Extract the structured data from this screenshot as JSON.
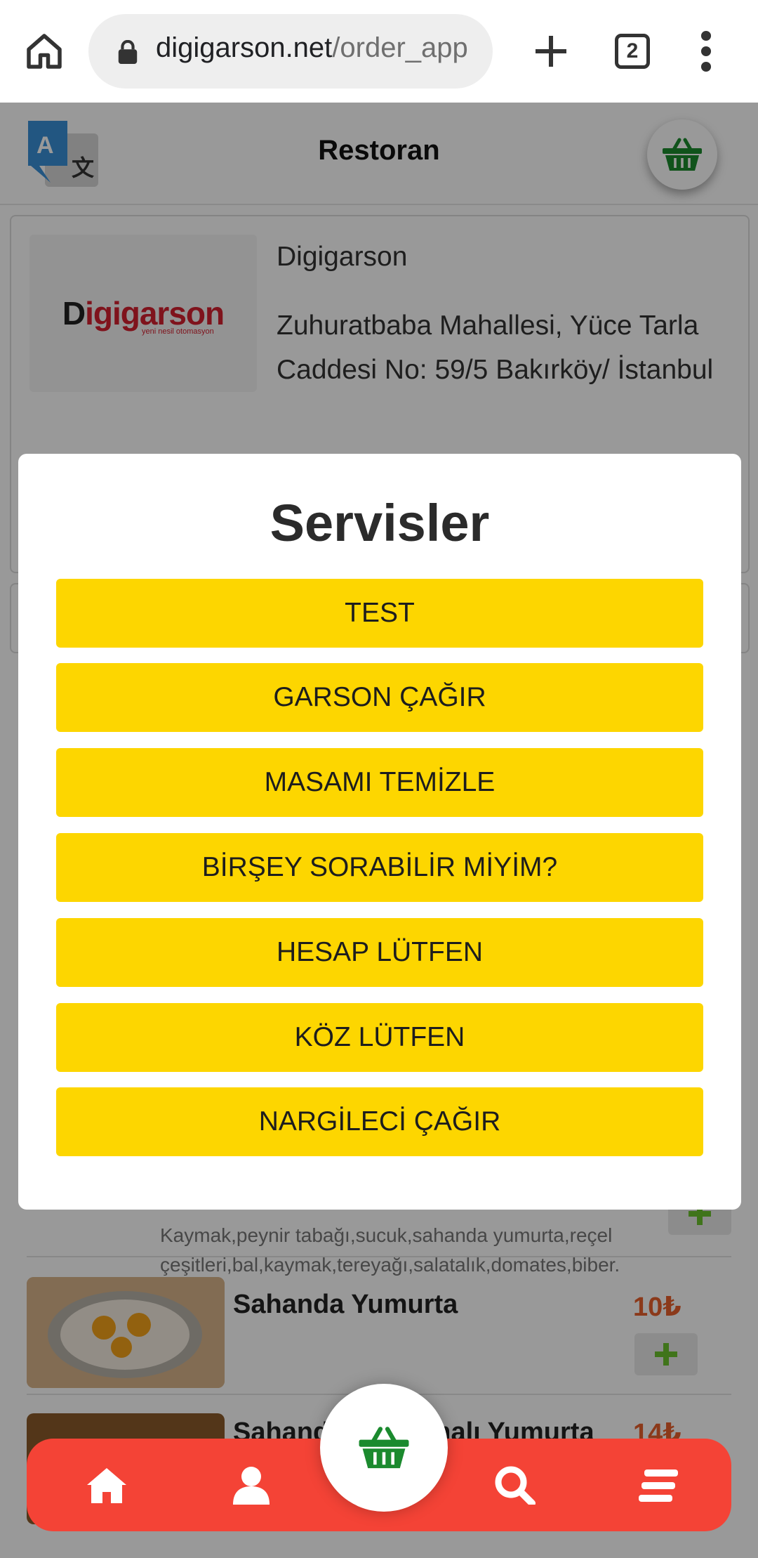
{
  "browser": {
    "url_host": "digigarson.net",
    "url_path": "/order_app",
    "tab_count": "2"
  },
  "header": {
    "title": "Restoran"
  },
  "restaurant": {
    "logo_text_d": "D",
    "logo_text_rest": "igigarson",
    "logo_tagline": "yeni nesil otomasyon",
    "name": "Digigarson",
    "address": "Zuhuratbaba Mahallesi, Yüce Tarla Caddesi No: 59/5 Bakırköy/ İstanbul"
  },
  "products": [
    {
      "description": "Kaymak,peynir tabağı,sucuk,sahanda yumurta,reçel çeşitleri,bal,kaymak,tereyağı,salatalık,domates,biber."
    },
    {
      "name": "Sahanda Yumurta",
      "price": "10₺"
    },
    {
      "name": "Sahanda Kavurmalı Yumurta",
      "price": "14₺"
    }
  ],
  "modal": {
    "title": "Servisler",
    "services": [
      "TEST",
      "GARSON ÇAĞIR",
      "MASAMI TEMİZLE",
      "BİRŞEY SORABİLİR MİYİM?",
      "HESAP LÜTFEN",
      "KÖZ LÜTFEN",
      "NARGİLECİ ÇAĞIR"
    ]
  },
  "icons": {
    "browser": [
      "home-icon",
      "lock-icon",
      "plus-icon",
      "tabs-icon",
      "more-vert-icon"
    ],
    "header": [
      "translate-icon",
      "basket-icon"
    ],
    "bottom_nav": [
      "home-icon",
      "user-icon",
      "basket-icon",
      "search-icon",
      "menu-icon"
    ]
  },
  "colors": {
    "accent_yellow": "#fdd600",
    "nav_red": "#f44336",
    "basket_green": "#1b8a2e",
    "price_orange": "#e8602c",
    "add_green": "#6cc22e"
  }
}
